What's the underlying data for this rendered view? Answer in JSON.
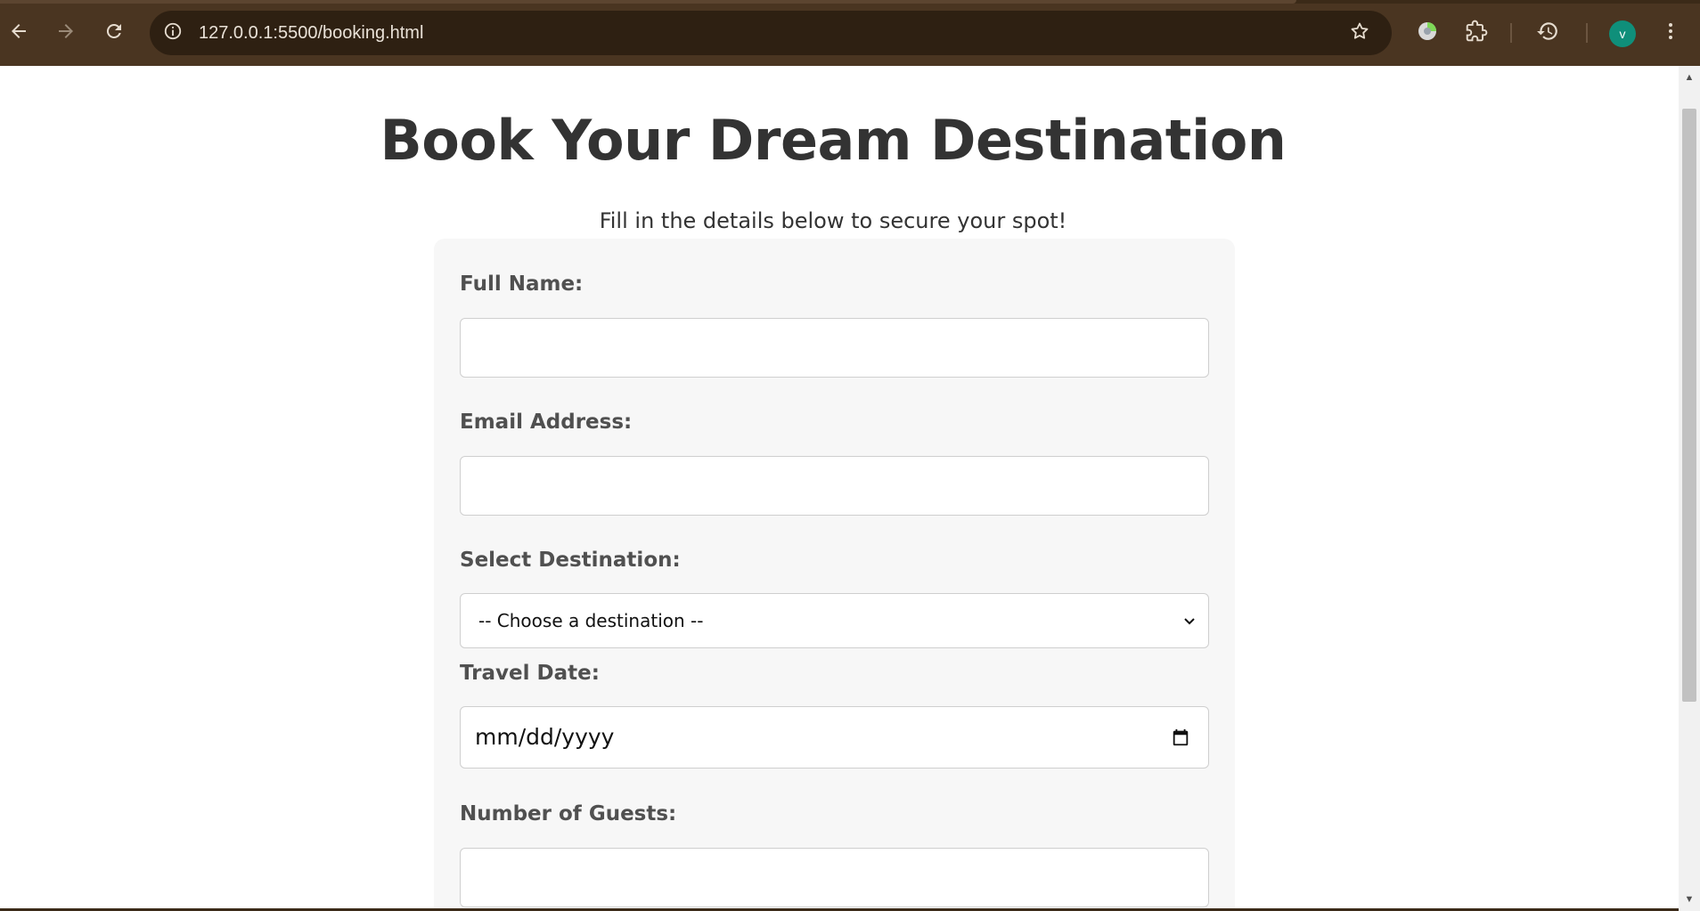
{
  "browser": {
    "url": "127.0.0.1:5500/booking.html",
    "avatar_letter": "v",
    "avatar_color": "#0f8f7a",
    "chrome_color": "#4a3521",
    "icons": [
      "back-arrow-icon",
      "forward-arrow-icon",
      "reload-icon",
      "site-info-icon",
      "bookmark-star-icon",
      "extension-icon",
      "puzzle-icon",
      "history-icon",
      "kebab-menu-icon"
    ]
  },
  "page": {
    "title": "Book Your Dream Destination",
    "subtitle": "Fill in the details below to secure your spot!"
  },
  "form": {
    "full_name_label": "Full Name:",
    "full_name_value": "",
    "email_label": "Email Address:",
    "email_value": "",
    "destination_label": "Select Destination:",
    "destination_selected": "-- Choose a destination --",
    "travel_date_label": "Travel Date:",
    "travel_date_placeholder": "mm/dd/yyyy",
    "guests_label": "Number of Guests:",
    "guests_value": ""
  }
}
